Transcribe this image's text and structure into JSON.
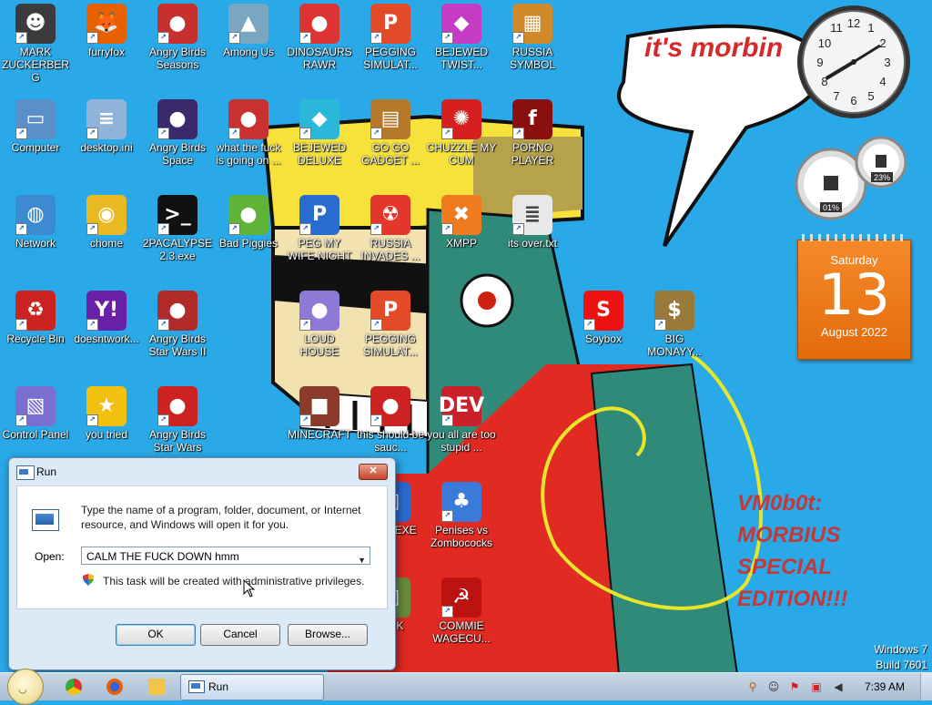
{
  "wallpaper": {
    "speech_bubble": "it's morbin",
    "caption": [
      "VM0b0t:",
      "MORBIUS",
      "SPECIAL",
      "EDITION!!!"
    ]
  },
  "desktop_icons": [
    {
      "label": "MARK ZUCKERBERG",
      "icon": "person-icon",
      "color": "#3b3b3b"
    },
    {
      "label": "furryfox",
      "icon": "firefox-icon",
      "color": "#e66000"
    },
    {
      "label": "Angry Birds Seasons",
      "icon": "angry-birds-icon",
      "color": "#c6302e"
    },
    {
      "label": "Among Us",
      "icon": "game-icon",
      "color": "#7aa6c2"
    },
    {
      "label": "DINOSAURS RAWR",
      "icon": "angry-birds-icon",
      "color": "#d33"
    },
    {
      "label": "PEGGING SIMULAT...",
      "icon": "peggle-icon",
      "color": "#e24a2a"
    },
    {
      "label": "BEJEWED TWIST...",
      "icon": "gem-icon",
      "color": "#c43cc4"
    },
    {
      "label": "RUSSIA SYMBOL",
      "icon": "blocks-icon",
      "color": "#d08a2a"
    },
    {
      "label": "Computer",
      "icon": "computer-icon",
      "color": "#5b8fc9"
    },
    {
      "label": "desktop.ini",
      "icon": "settings-file-icon",
      "color": "#8fb3d9"
    },
    {
      "label": "Angry Birds Space",
      "icon": "angry-birds-icon",
      "color": "#3b2a6b"
    },
    {
      "label": "what the fuck is going on ...",
      "icon": "angry-birds-icon",
      "color": "#c93030"
    },
    {
      "label": "BEJEWED DELUXE",
      "icon": "gem-icon",
      "color": "#2ab7d9"
    },
    {
      "label": "GO GO GADGET ...",
      "icon": "briefcase-icon",
      "color": "#b5792a"
    },
    {
      "label": "CHUZZLE MY CUM",
      "icon": "chuzzle-icon",
      "color": "#d62020"
    },
    {
      "label": "PORNO PLAYER",
      "icon": "flash-icon",
      "color": "#8a0f0f"
    },
    {
      "label": "Network",
      "icon": "network-icon",
      "color": "#3c8bd1"
    },
    {
      "label": "chome",
      "icon": "chrome-icon",
      "color": "#e8b923"
    },
    {
      "label": "2PACALYPSE 2.3.exe",
      "icon": "terminal-icon",
      "color": "#111111"
    },
    {
      "label": "Bad Piggies",
      "icon": "pig-icon",
      "color": "#5fb336"
    },
    {
      "label": "PEG MY WIFE NIGHT",
      "icon": "peggle-icon",
      "color": "#2a6bd0"
    },
    {
      "label": "RUSSIA INVADES ...",
      "icon": "radiation-icon",
      "color": "#e2372a"
    },
    {
      "label": "XMPP",
      "icon": "xampp-icon",
      "color": "#f07a1e"
    },
    {
      "label": "its over.txt",
      "icon": "text-file-icon",
      "color": "#e8e8e8"
    },
    {
      "label": "Recycle Bin",
      "icon": "recycle-bin-icon",
      "color": "#c22"
    },
    {
      "label": "doesntwork...",
      "icon": "yahoo-icon",
      "color": "#6a1fa8"
    },
    {
      "label": "Angry Birds Star Wars II",
      "icon": "angry-birds-icon",
      "color": "#b02a2a"
    },
    {
      "label": "LOUD HOUSE",
      "icon": "angry-birds-icon",
      "color": "#8e7ad6"
    },
    {
      "label": "PEGGING SIMULAT...",
      "icon": "peggle-icon",
      "color": "#e24a2a"
    },
    {
      "label": "Soybox",
      "icon": "soybox-icon",
      "color": "#e11"
    },
    {
      "label": "BIG MONAYY...",
      "icon": "money-bag-icon",
      "color": "#9a7a3a"
    },
    {
      "label": "Control Panel",
      "icon": "control-panel-icon",
      "color": "#7a6fd0"
    },
    {
      "label": "you tried",
      "icon": "star-icon",
      "color": "#f2c10f"
    },
    {
      "label": "Angry Birds Star Wars",
      "icon": "angry-birds-icon",
      "color": "#c22"
    },
    {
      "label": "MINECRAFT",
      "icon": "minecraft-icon",
      "color": "#8a3b2a"
    },
    {
      "label": "this should be sauc...",
      "icon": "angry-birds-icon",
      "color": "#c22"
    },
    {
      "label": "you all are too stupid ...",
      "icon": "dev-cpp-icon",
      "color": "#c9202a"
    },
    {
      "label": "ED 2 .EXE",
      "icon": "app-icon",
      "color": "#2a6bd0"
    },
    {
      "label": "Penises vs Zombococks",
      "icon": "plants-icon",
      "color": "#3a7ad8"
    },
    {
      "label": "DICK",
      "icon": "app-icon",
      "color": "#6a8a3a"
    },
    {
      "label": "COMMIE WAGECU...",
      "icon": "commie-icon",
      "color": "#b11"
    }
  ],
  "gadgets": {
    "clock_time": "7:39",
    "cpu_meter": [
      "01%",
      "23%"
    ],
    "calendar": {
      "weekday": "Saturday",
      "day": "13",
      "month_year": "August 2022"
    }
  },
  "run_dialog": {
    "title": "Run",
    "close": "✕",
    "description": "Type the name of a program, folder, document, or Internet resource, and Windows will open it for you.",
    "open_label": "Open:",
    "open_value": "CALM THE FUCK DOWN hmm",
    "admin_note": "This task will be created with administrative privileges.",
    "buttons": {
      "ok": "OK",
      "cancel": "Cancel",
      "browse": "Browse..."
    }
  },
  "watermark": {
    "line1": "Windows 7",
    "line2": "Build 7601"
  },
  "taskbar": {
    "task_label": "Run",
    "clock": "7:39 AM"
  }
}
